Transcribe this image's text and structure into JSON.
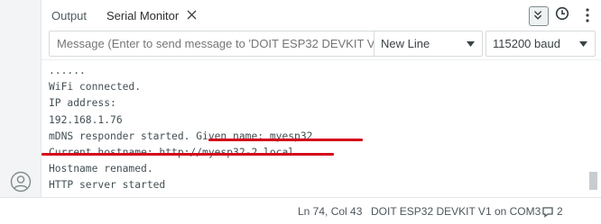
{
  "tabs": {
    "output_label": "Output",
    "serial_label": "Serial Monitor",
    "icons": [
      "close-icon",
      "timestamp-toggle-icon",
      "clock-icon",
      "more-icon"
    ]
  },
  "input": {
    "message_placeholder": "Message (Enter to send message to 'DOIT ESP32 DEVKIT V..."
  },
  "line_ending": {
    "selected": "New Line"
  },
  "baud": {
    "selected": "115200 baud"
  },
  "output": {
    "lines": [
      "......",
      "WiFi connected.",
      "IP address:",
      "192.168.1.76",
      "mDNS responder started. Given name: myesp32",
      "Current hostname: http://myesp32-2.local",
      "Hostname renamed.",
      "HTTP server started"
    ],
    "highlight_color": "#d4071a"
  },
  "status": {
    "position": "Ln 74, Col 43",
    "board": "DOIT ESP32 DEVKIT V1 on COM3",
    "notifications": "2"
  }
}
